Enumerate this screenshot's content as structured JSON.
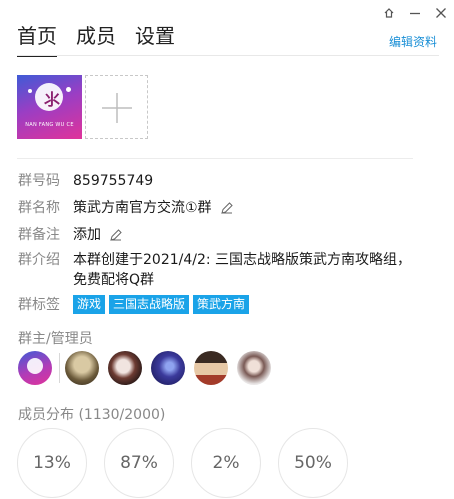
{
  "window": {
    "icons": [
      "pin-icon",
      "minimize-icon",
      "close-icon"
    ]
  },
  "tabs": [
    {
      "label": "首页",
      "active": true
    },
    {
      "label": "成员",
      "active": false
    },
    {
      "label": "设置",
      "active": false
    }
  ],
  "edit_profile_label": "编辑资料",
  "group_avatar": {
    "logo_text": "NAN FANG WU CE"
  },
  "info": {
    "id_key": "群号码",
    "id_value": "859755749",
    "name_key": "群名称",
    "name_value": "策武方南官方交流①群",
    "note_key": "群备注",
    "note_value": "添加",
    "intro_key": "群介绍",
    "intro_value": "本群创建于2021/4/2:  三国志战略版策武方南攻略组，免费配将Q群",
    "tags_key": "群标签",
    "tags": [
      "游戏",
      "三国志战略版",
      "策武方南"
    ]
  },
  "admins_title": "群主/管理员",
  "distribution": {
    "title": "成员分布",
    "count": "(1130/2000)",
    "percents": [
      "13%",
      "87%",
      "2%",
      "50%"
    ]
  },
  "colors": {
    "accent": "#1a8fd6",
    "tag_bg": "#1aa3e8"
  }
}
